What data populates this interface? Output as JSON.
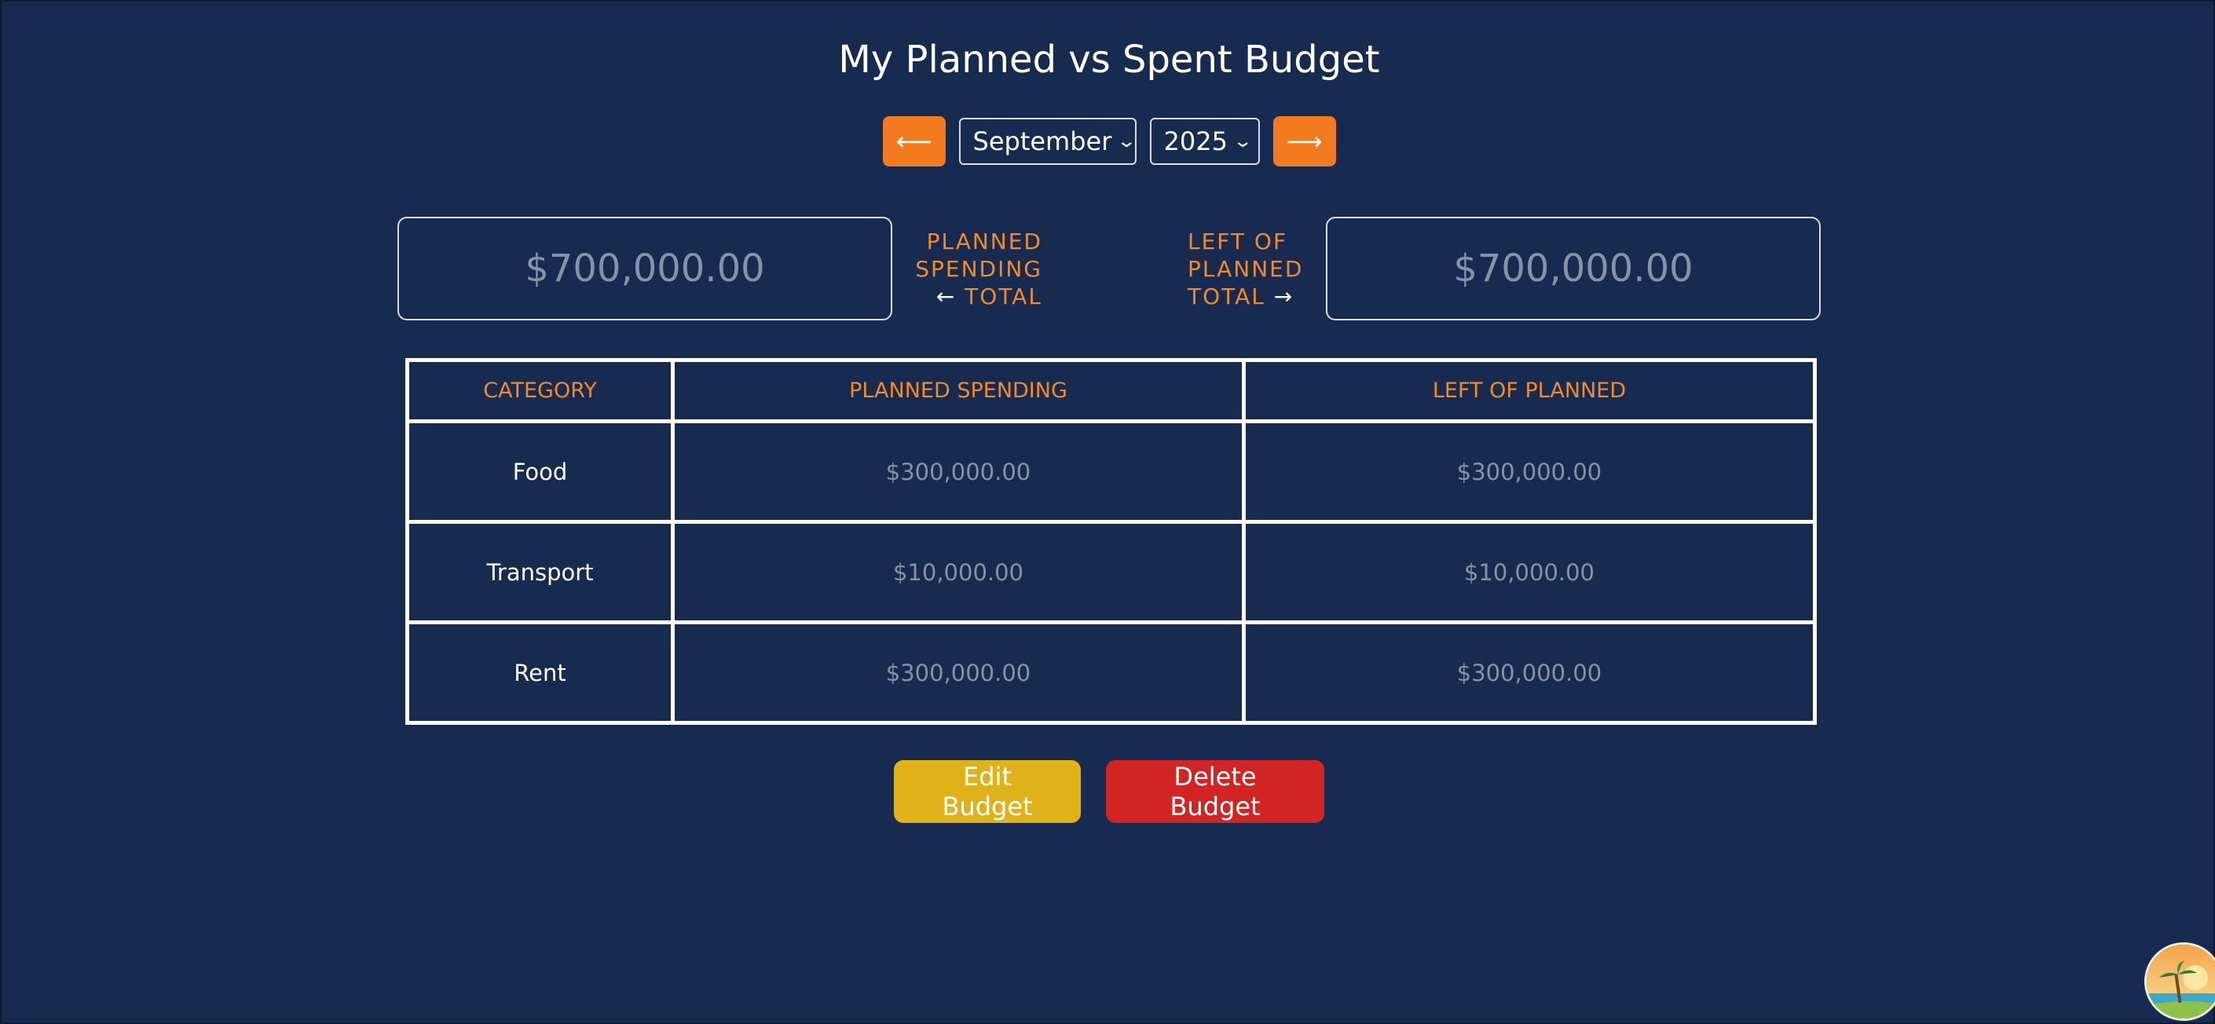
{
  "page": {
    "title": "My Planned vs Spent Budget"
  },
  "nav": {
    "prev_icon": "arrow-left-icon",
    "prev_glyph": "⟵",
    "next_icon": "arrow-right-icon",
    "next_glyph": "⟶",
    "month_selected": "September",
    "year_selected": "2025",
    "chevron_glyph": "⌄"
  },
  "totals": {
    "planned_value": "$700,000.00",
    "planned_label_line1": "PLANNED",
    "planned_label_line2": "SPENDING",
    "planned_label_arrow": "←",
    "planned_label_line3": "TOTAL",
    "left_value": "$700,000.00",
    "left_label_line1": "LEFT OF",
    "left_label_line2": "PLANNED",
    "left_label_line3": "TOTAL",
    "left_label_arrow": "→"
  },
  "table": {
    "headers": [
      "CATEGORY",
      "PLANNED SPENDING",
      "LEFT OF PLANNED"
    ],
    "rows": [
      {
        "category": "Food",
        "planned": "$300,000.00",
        "left": "$300,000.00"
      },
      {
        "category": "Transport",
        "planned": "$10,000.00",
        "left": "$10,000.00"
      },
      {
        "category": "Rent",
        "planned": "$300,000.00",
        "left": "$300,000.00"
      }
    ]
  },
  "actions": {
    "edit_label": "Edit Budget",
    "delete_label": "Delete Budget"
  },
  "colors": {
    "background": "#172a4f",
    "accent_orange": "#f37a1f",
    "label_orange": "#f08a2c",
    "edit_yellow": "#e0b21a",
    "delete_red": "#d32424",
    "muted_amount": "#8592a8"
  },
  "avatar": {
    "icon": "beach-avatar-icon"
  }
}
